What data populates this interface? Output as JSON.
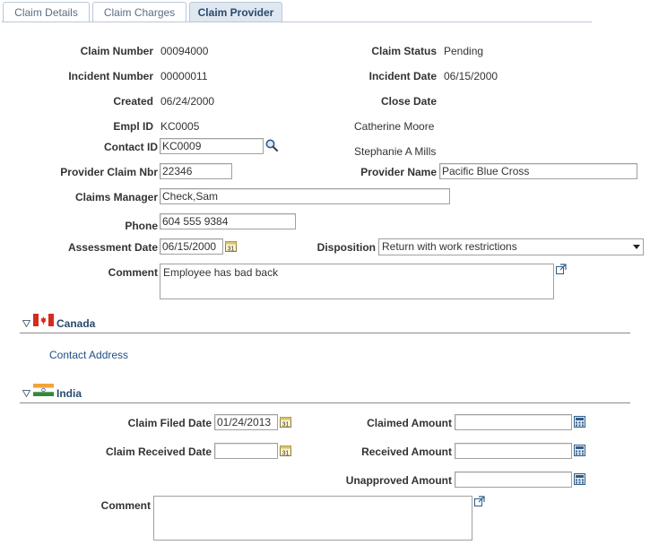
{
  "tabs": [
    {
      "label": "Claim Details"
    },
    {
      "label": "Claim Charges"
    },
    {
      "label": "Claim Provider"
    }
  ],
  "claim": {
    "claim_number_label": "Claim Number",
    "claim_number": "00094000",
    "claim_status_label": "Claim Status",
    "claim_status": "Pending",
    "incident_number_label": "Incident Number",
    "incident_number": "00000011",
    "incident_date_label": "Incident Date",
    "incident_date": "06/15/2000",
    "created_label": "Created",
    "created": "06/24/2000",
    "close_date_label": "Close Date",
    "empl_id_label": "Empl ID",
    "empl_id": "KC0005",
    "empl_name": "Catherine Moore",
    "contact_id_label": "Contact ID",
    "contact_id": "KC0009",
    "contact_name": "Stephanie A Mills",
    "provider_claim_nbr_label": "Provider Claim Nbr",
    "provider_claim_nbr": "22346",
    "provider_name_label": "Provider Name",
    "provider_name": "Pacific Blue Cross",
    "claims_manager_label": "Claims Manager",
    "claims_manager": "Check,Sam",
    "phone_label": "Phone",
    "phone": "604 555 9384",
    "assessment_date_label": "Assessment Date",
    "assessment_date": "06/15/2000",
    "disposition_label": "Disposition",
    "disposition": "Return with work restrictions",
    "comment_label": "Comment",
    "comment": "Employee has bad back"
  },
  "canada": {
    "title": "Canada",
    "contact_address_link": "Contact Address"
  },
  "india": {
    "title": "India",
    "claim_filed_date_label": "Claim Filed Date",
    "claim_filed_date": "01/24/2013",
    "claimed_amount_label": "Claimed Amount",
    "claimed_amount": "",
    "claim_received_date_label": "Claim Received Date",
    "claim_received_date": "",
    "received_amount_label": "Received Amount",
    "received_amount": "",
    "unapproved_amount_label": "Unapproved Amount",
    "unapproved_amount": "",
    "comment_label": "Comment",
    "comment": ""
  },
  "colors": {
    "section_title": "#2a4a6e",
    "link": "#1f4e87",
    "tab_active_bg": "#dfe7f0"
  },
  "icons": {
    "lookup": "magnifier-icon",
    "calendar": "calendar-icon",
    "calculator": "calculator-icon",
    "expand": "expand-icon",
    "collapse": "triangle-down-icon"
  }
}
